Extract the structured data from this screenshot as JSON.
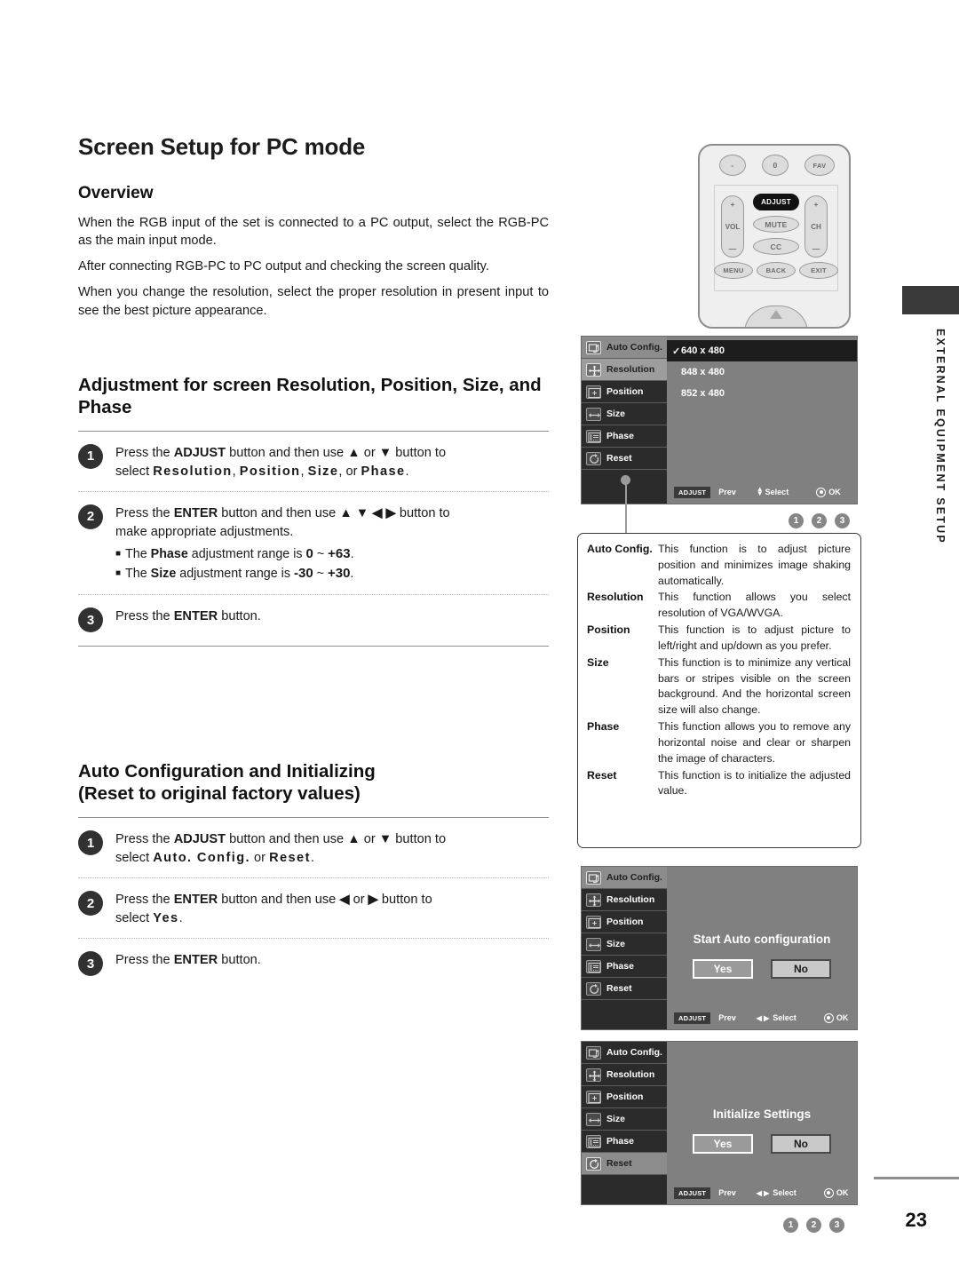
{
  "page": {
    "title": "Screen Setup for PC mode",
    "number": "23",
    "side_tab_label": "EXTERNAL EQUIPMENT SETUP"
  },
  "overview": {
    "heading": "Overview",
    "paragraphs": [
      "When the RGB input of the set is connected to a PC output, select the RGB-PC as the main input mode.",
      "After connecting RGB-PC to PC output and checking the screen quality.",
      "When you change the resolution, select the proper resolution in present input to see the best picture appearance."
    ]
  },
  "adjustment_section": {
    "heading": "Adjustment for screen Resolution, Position, Size, and Phase",
    "steps": [
      {
        "num": "1",
        "lines": [
          "Press the ADJUST button and then use ▲ or ▼ button to",
          "select Resolution, Position, Size, or Phase."
        ]
      },
      {
        "num": "2",
        "lines": [
          "Press the ENTER button and then use ▲ ▼ ◀ ▶ button to",
          "make appropriate adjustments."
        ],
        "bullets": [
          "The Phase adjustment range is 0 ~ +63.",
          "The Size adjustment range is -30 ~ +30."
        ]
      },
      {
        "num": "3",
        "lines": [
          "Press the ENTER button."
        ]
      }
    ]
  },
  "autoconfig_section": {
    "heading_line1": "Auto Configuration and Initializing",
    "heading_line2": "(Reset to original factory values)",
    "steps": [
      {
        "num": "1",
        "lines": [
          "Press the ADJUST button and then use ▲ or ▼ button to",
          "select Auto. Config. or Reset."
        ]
      },
      {
        "num": "2",
        "lines": [
          "Press the ENTER button and then use ◀ or ▶ button to",
          "select Yes."
        ]
      },
      {
        "num": "3",
        "lines": [
          "Press the ENTER button."
        ]
      }
    ]
  },
  "remote": {
    "keys": {
      "dash": "-",
      "zero": "0",
      "fav": "FAV",
      "vol": "VOL",
      "ch": "CH",
      "plus": "+",
      "minus": "—",
      "adjust": "ADJUST",
      "mute": "MUTE",
      "cc": "CC",
      "menu": "MENU",
      "back": "BACK",
      "exit": "EXIT"
    }
  },
  "osd_menu_items": [
    {
      "label": "Auto Config.",
      "icon": "auto-config-icon"
    },
    {
      "label": "Resolution",
      "icon": "resolution-icon"
    },
    {
      "label": "Position",
      "icon": "position-icon"
    },
    {
      "label": "Size",
      "icon": "size-icon"
    },
    {
      "label": "Phase",
      "icon": "phase-icon"
    },
    {
      "label": "Reset",
      "icon": "reset-icon"
    }
  ],
  "osd_resolution": {
    "options": [
      "640 x 480",
      "848 x 480",
      "852 x 480"
    ],
    "selected": "640 x 480",
    "check": "✓",
    "footer": {
      "key": "ADJUST",
      "prev": "Prev",
      "select": "Select",
      "ok": "OK"
    },
    "step_dots": [
      "1",
      "2",
      "3"
    ]
  },
  "osd_autoconfig": {
    "title": "Start Auto configuration",
    "yes": "Yes",
    "no": "No",
    "footer": {
      "key": "ADJUST",
      "prev": "Prev",
      "select": "Select",
      "ok": "OK"
    }
  },
  "osd_reset": {
    "title": "Initialize Settings",
    "yes": "Yes",
    "no": "No",
    "footer": {
      "key": "ADJUST",
      "prev": "Prev",
      "select": "Select",
      "ok": "OK"
    },
    "step_dots": [
      "1",
      "2",
      "3"
    ]
  },
  "descriptions": [
    {
      "term": "Auto Config.",
      "text": "This function is to adjust picture position and minimizes image shaking automatically."
    },
    {
      "term": "Resolution",
      "text": "This function allows you select resolution of VGA/WVGA."
    },
    {
      "term": "Position",
      "text": "This function is to adjust picture to left/right and up/down as you prefer."
    },
    {
      "term": "Size",
      "text": "This function is to minimize any vertical bars or stripes visible on the screen background. And the horizontal screen size will also change."
    },
    {
      "term": "Phase",
      "text": "This function allows you to remove any horizontal noise and clear or sharpen the image of characters."
    },
    {
      "term": "Reset",
      "text": "This function is to initialize the adjusted value."
    }
  ]
}
